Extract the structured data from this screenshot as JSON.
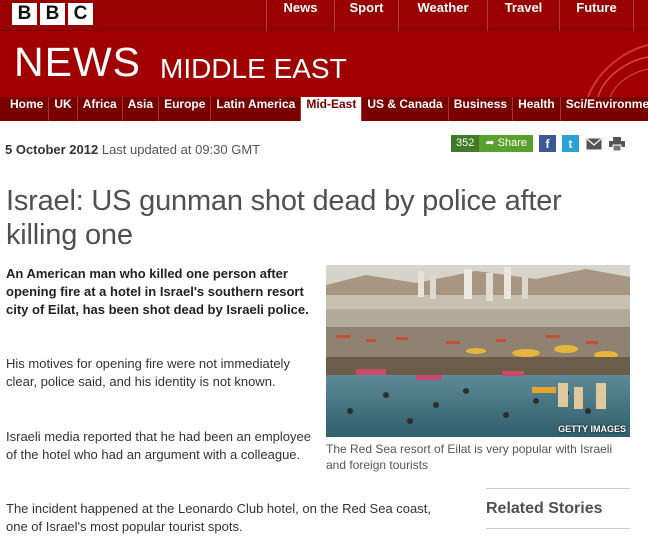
{
  "brand": {
    "letters": [
      "B",
      "B",
      "C"
    ]
  },
  "topnav": [
    "News",
    "Sport",
    "Weather",
    "Travel",
    "Future"
  ],
  "masthead": {
    "title": "NEWS",
    "section": "MIDDLE EAST"
  },
  "secnav": [
    {
      "label": "Home"
    },
    {
      "label": "UK"
    },
    {
      "label": "Africa"
    },
    {
      "label": "Asia"
    },
    {
      "label": "Europe"
    },
    {
      "label": "Latin America"
    },
    {
      "label": "Mid-East",
      "active": true
    },
    {
      "label": "US & Canada"
    },
    {
      "label": "Business"
    },
    {
      "label": "Health"
    },
    {
      "label": "Sci/Environment"
    }
  ],
  "article": {
    "date": "5 October 2012",
    "updated": "Last updated at 09:30 GMT",
    "share_count": "352",
    "share_label": "Share",
    "headline": "Israel: US gunman shot dead by police after killing one",
    "intro": "An American man who killed one person after opening fire at a hotel in Israel's southern resort city of Eilat, has been shot dead by Israeli police.",
    "paragraphs": [
      "His motives for opening fire were not immediately clear, police said, and his identity is not known.",
      "Israeli media reported that he had been an employee of the hotel who had an argument with a colleague.",
      "The incident happened at the Leonardo Club hotel, on the Red Sea coast, one of Israel's most popular tourist spots."
    ],
    "photo_credit": "GETTY IMAGES",
    "caption": "The Red Sea resort of Eilat is very popular with Israeli and foreign tourists"
  },
  "sidebar": {
    "related_title": "Related Stories"
  }
}
